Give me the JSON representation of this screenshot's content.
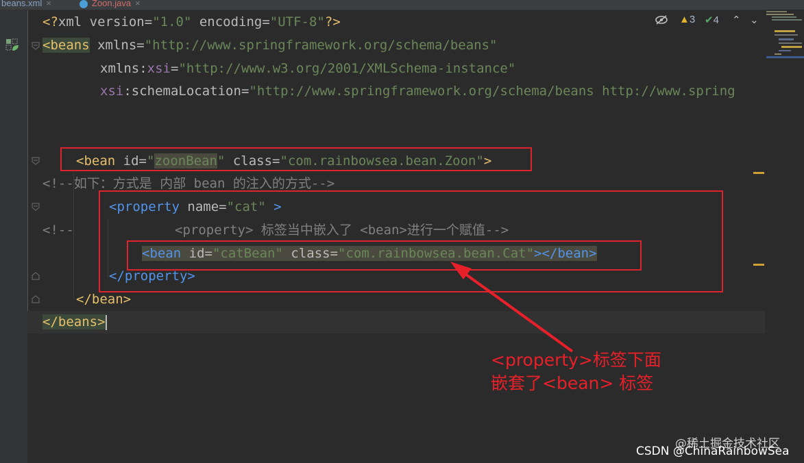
{
  "tabs": [
    {
      "label": "beans.xml",
      "close": "×"
    },
    {
      "label": "Zoon.java",
      "close": "×"
    }
  ],
  "inspections": {
    "warnings": "3",
    "ok": "4"
  },
  "code": {
    "line1": {
      "open": "<?",
      "kw1": "xml version",
      "eq1": "=",
      "v1": "\"1.0\"",
      "kw2": " encoding",
      "eq2": "=",
      "v2": "\"UTF-8\"",
      "close": "?>"
    },
    "line2": {
      "tag": "<beans",
      "attr": " xmlns",
      "eq": "=",
      "val": "\"http://www.springframework.org/schema/beans\""
    },
    "line3": {
      "ns": "xmlns",
      "colon": ":",
      "nsname": "xsi",
      "eq": "=",
      "val": "\"http://www.w3.org/2001/XMLSchema-instance\""
    },
    "line4": {
      "ns": "xsi",
      "colon": ":",
      "attr": "schemaLocation",
      "eq": "=",
      "val": "\"http://www.springframework.org/schema/beans http://www.spring"
    },
    "line6": {
      "tag": "<bean",
      "attr1": " id",
      "eq1": "=",
      "q1": "\"",
      "v1": "zoonBean",
      "q1b": "\"",
      "attr2": " class",
      "eq2": "=",
      "v2": "\"com.rainbowsea.bean.Zoon\"",
      "close": ">"
    },
    "line7": {
      "comment": "<!--如下：方式是 内部 bean 的注入的方式-->"
    },
    "line8": {
      "tag": "<property",
      "attr": " name",
      "eq": "=",
      "val": "\"cat\"",
      "close": " >"
    },
    "line9": {
      "cstart": "<!--",
      "ctext": "<property> 标签当中嵌入了 <bean>进行一个赋值-->"
    },
    "line10": {
      "tag": "<bean",
      "attr1": " id",
      "eq1": "=",
      "v1": "\"catBean\"",
      "attr2": " class",
      "eq2": "=",
      "v2": "\"com.rainbowsea.bean.Cat\"",
      "close": ">",
      "endtag": "</bean>"
    },
    "line11": {
      "endtag": "</property>"
    },
    "line12": {
      "endtag": "</bean>"
    },
    "line13": {
      "endtag": "</beans",
      "gt": ">"
    }
  },
  "annotation": {
    "line1": "<property>标签下面",
    "line2": "嵌套了<bean> 标签"
  },
  "watermarks": {
    "juejin": "@稀土掘金技术社区",
    "csdn": "CSDN @ChinaRainbowSea"
  },
  "colors": {
    "background": "#2b2b2b",
    "annotation": "#e8202a",
    "redbox": "#e0242f"
  }
}
